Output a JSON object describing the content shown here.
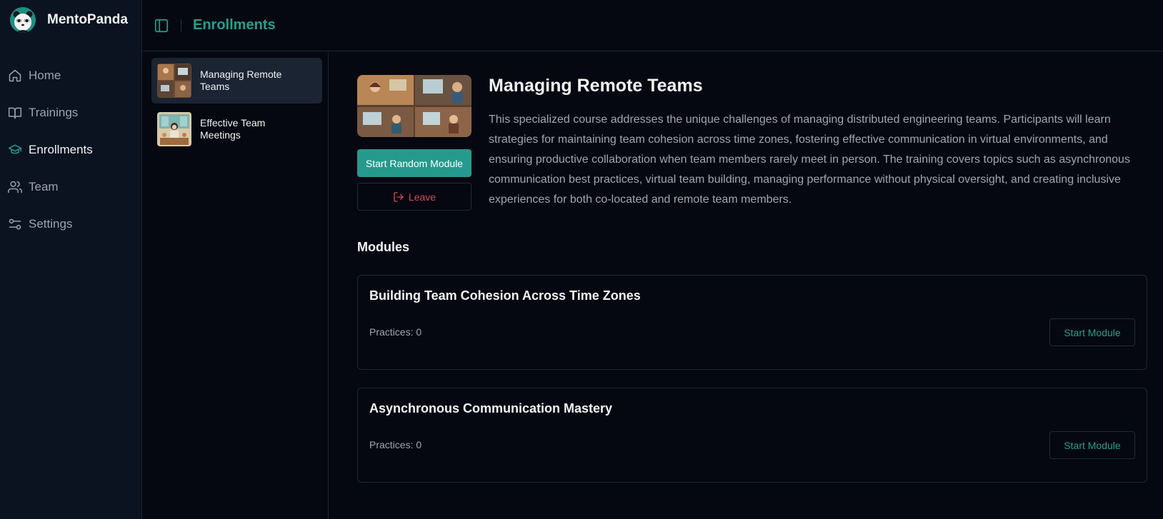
{
  "app": {
    "name": "MentoPanda",
    "accent_color": "#2a9d8f",
    "logo_icon": "panda-logo-icon"
  },
  "sidebar": {
    "items": [
      {
        "label": "Home",
        "icon": "home-icon",
        "active": false
      },
      {
        "label": "Trainings",
        "icon": "book-icon",
        "active": false
      },
      {
        "label": "Enrollments",
        "icon": "graduation-cap-icon",
        "active": true
      },
      {
        "label": "Team",
        "icon": "users-icon",
        "active": false
      },
      {
        "label": "Settings",
        "icon": "sliders-icon",
        "active": false
      }
    ]
  },
  "header": {
    "title": "Enrollments",
    "toggle_icon": "sidebar-toggle-icon"
  },
  "enrollments": [
    {
      "title": "Managing Remote Teams",
      "active": true
    },
    {
      "title": "Effective Team Meetings",
      "active": false
    }
  ],
  "course": {
    "title": "Managing Remote Teams",
    "description": "This specialized course addresses the unique challenges of managing distributed engineering teams. Participants will learn strategies for maintaining team cohesion across time zones, fostering effective communication in virtual environments, and ensuring productive collaboration when team members rarely meet in person. The training covers topics such as asynchronous communication best practices, virtual team building, managing performance without physical oversight, and creating inclusive experiences for both co-located and remote team members.",
    "start_random_label": "Start Random Module",
    "leave_label": "Leave",
    "leave_icon": "log-out-icon",
    "leave_color": "#d8495c"
  },
  "modules": {
    "heading": "Modules",
    "items": [
      {
        "title": "Building Team Cohesion Across Time Zones",
        "practices": "Practices: 0",
        "button_label": "Start Module"
      },
      {
        "title": "Asynchronous Communication Mastery",
        "practices": "Practices: 0",
        "button_label": "Start Module"
      }
    ]
  }
}
